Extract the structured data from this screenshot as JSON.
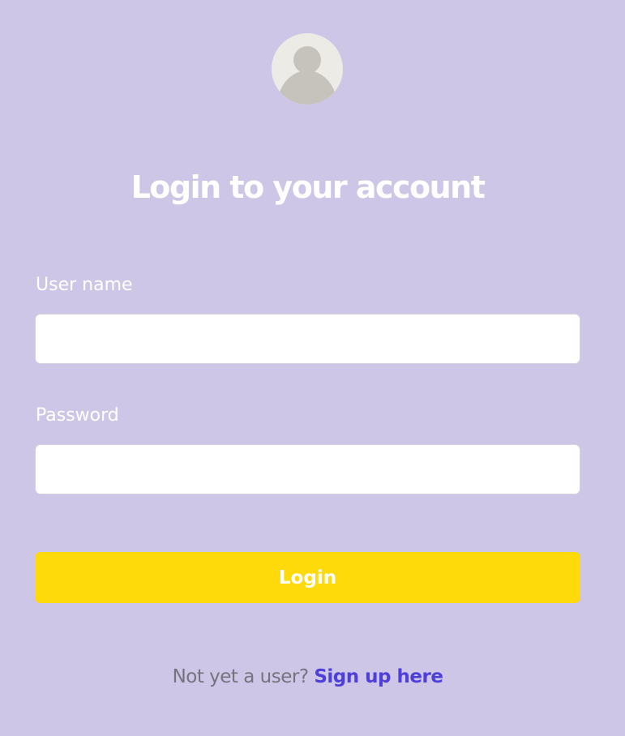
{
  "header": {
    "avatar_icon": "user-avatar-icon",
    "title": "Login to your account"
  },
  "form": {
    "username_label": "User name",
    "username_value": "",
    "password_label": "Password",
    "password_value": "",
    "submit_label": "Login"
  },
  "footer": {
    "prompt": "Not yet a user?",
    "signup_link": "Sign up here"
  },
  "colors": {
    "background": "#cec6e6",
    "button": "#ffda0b",
    "link": "#4e3fdb",
    "prompt_text": "#74737f"
  }
}
